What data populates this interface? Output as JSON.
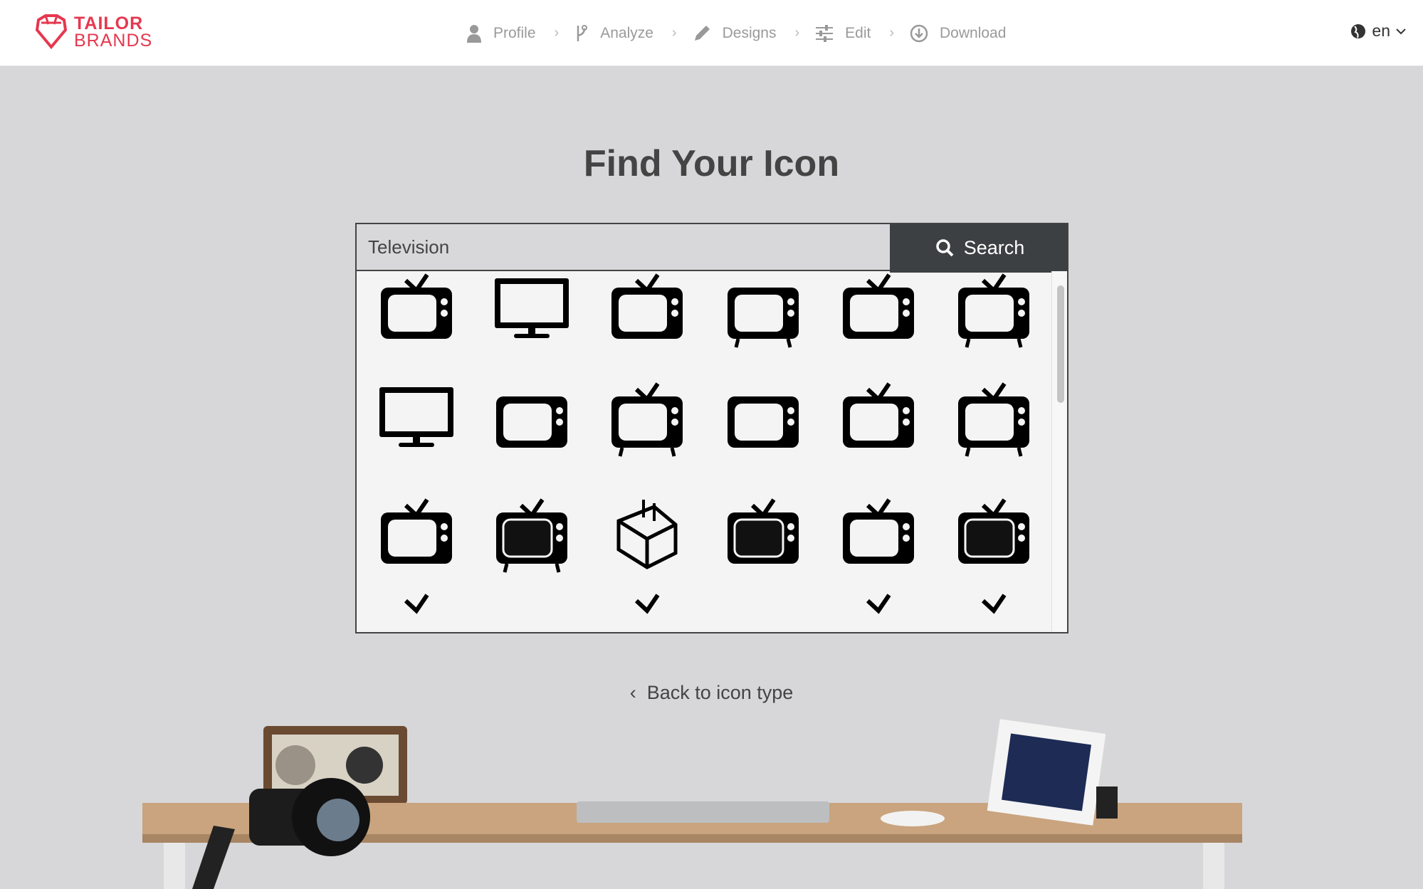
{
  "brand": {
    "line1": "TAILOR",
    "line2": "BRANDS",
    "color": "#e5384f"
  },
  "nav": {
    "steps": [
      {
        "label": "Profile",
        "icon": "user-icon"
      },
      {
        "label": "Analyze",
        "icon": "branch-icon"
      },
      {
        "label": "Designs",
        "icon": "pencil-icon"
      },
      {
        "label": "Edit",
        "icon": "sliders-icon"
      },
      {
        "label": "Download",
        "icon": "download-icon"
      }
    ]
  },
  "language": {
    "value": "en",
    "icon": "globe-icon"
  },
  "page": {
    "title": "Find Your Icon"
  },
  "search": {
    "value": "Television",
    "button_label": "Search",
    "icon": "search-icon"
  },
  "results": {
    "icons": [
      "tv-retro",
      "monitor",
      "tv-rounded",
      "tv-legs",
      "tv-antenna-block",
      "tv-vintage-dials",
      "monitor-large",
      "tv-small-antenna",
      "tv-crt-legs",
      "tv-outline-antenna",
      "tv-on-stand",
      "tv-wide-antenna",
      "tv-rabbit-ears",
      "tv-panel-vintage",
      "tv-isometric",
      "tv-screen-filled",
      "tv-dials-round",
      "computer-terminal",
      "tv-partial",
      "tv-partial",
      "tv-partial",
      "tv-partial",
      "tv-partial",
      "tv-partial"
    ]
  },
  "back_link": "Back to icon type"
}
